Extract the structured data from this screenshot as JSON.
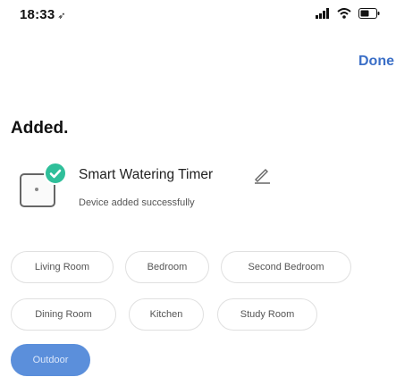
{
  "status_bar": {
    "time": "18:33",
    "location_glyph": "➶"
  },
  "header": {
    "done_label": "Done"
  },
  "page": {
    "heading": "Added."
  },
  "device": {
    "name": "Smart Watering Timer",
    "status": "Device added successfully"
  },
  "rooms": [
    {
      "label": "Living Room",
      "selected": false
    },
    {
      "label": "Bedroom",
      "selected": false
    },
    {
      "label": "Second Bedroom",
      "selected": false
    },
    {
      "label": "Dining Room",
      "selected": false
    },
    {
      "label": "Kitchen",
      "selected": false
    },
    {
      "label": "Study Room",
      "selected": false
    },
    {
      "label": "Outdoor",
      "selected": true
    }
  ],
  "colors": {
    "accent": "#3b6fc7",
    "chip_selected": "#5b8fdb",
    "success": "#2fbf9a"
  }
}
